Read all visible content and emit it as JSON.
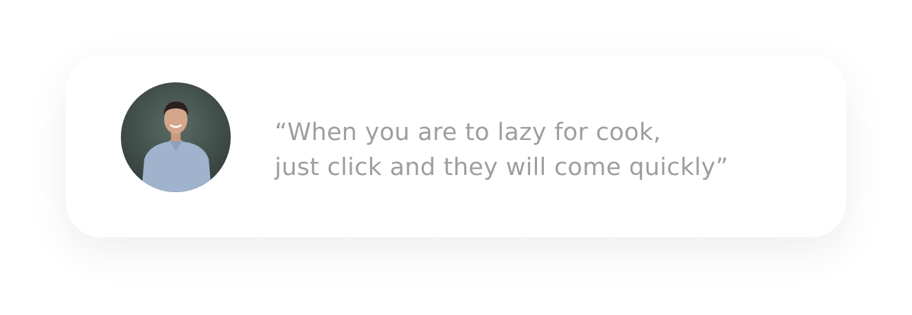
{
  "testimonial": {
    "avatar_icon": "person-photo",
    "quote_lines": [
      "“When you are to lazy for cook,",
      "just click and they will come quickly”"
    ],
    "text_color": "#9e9e9e"
  }
}
